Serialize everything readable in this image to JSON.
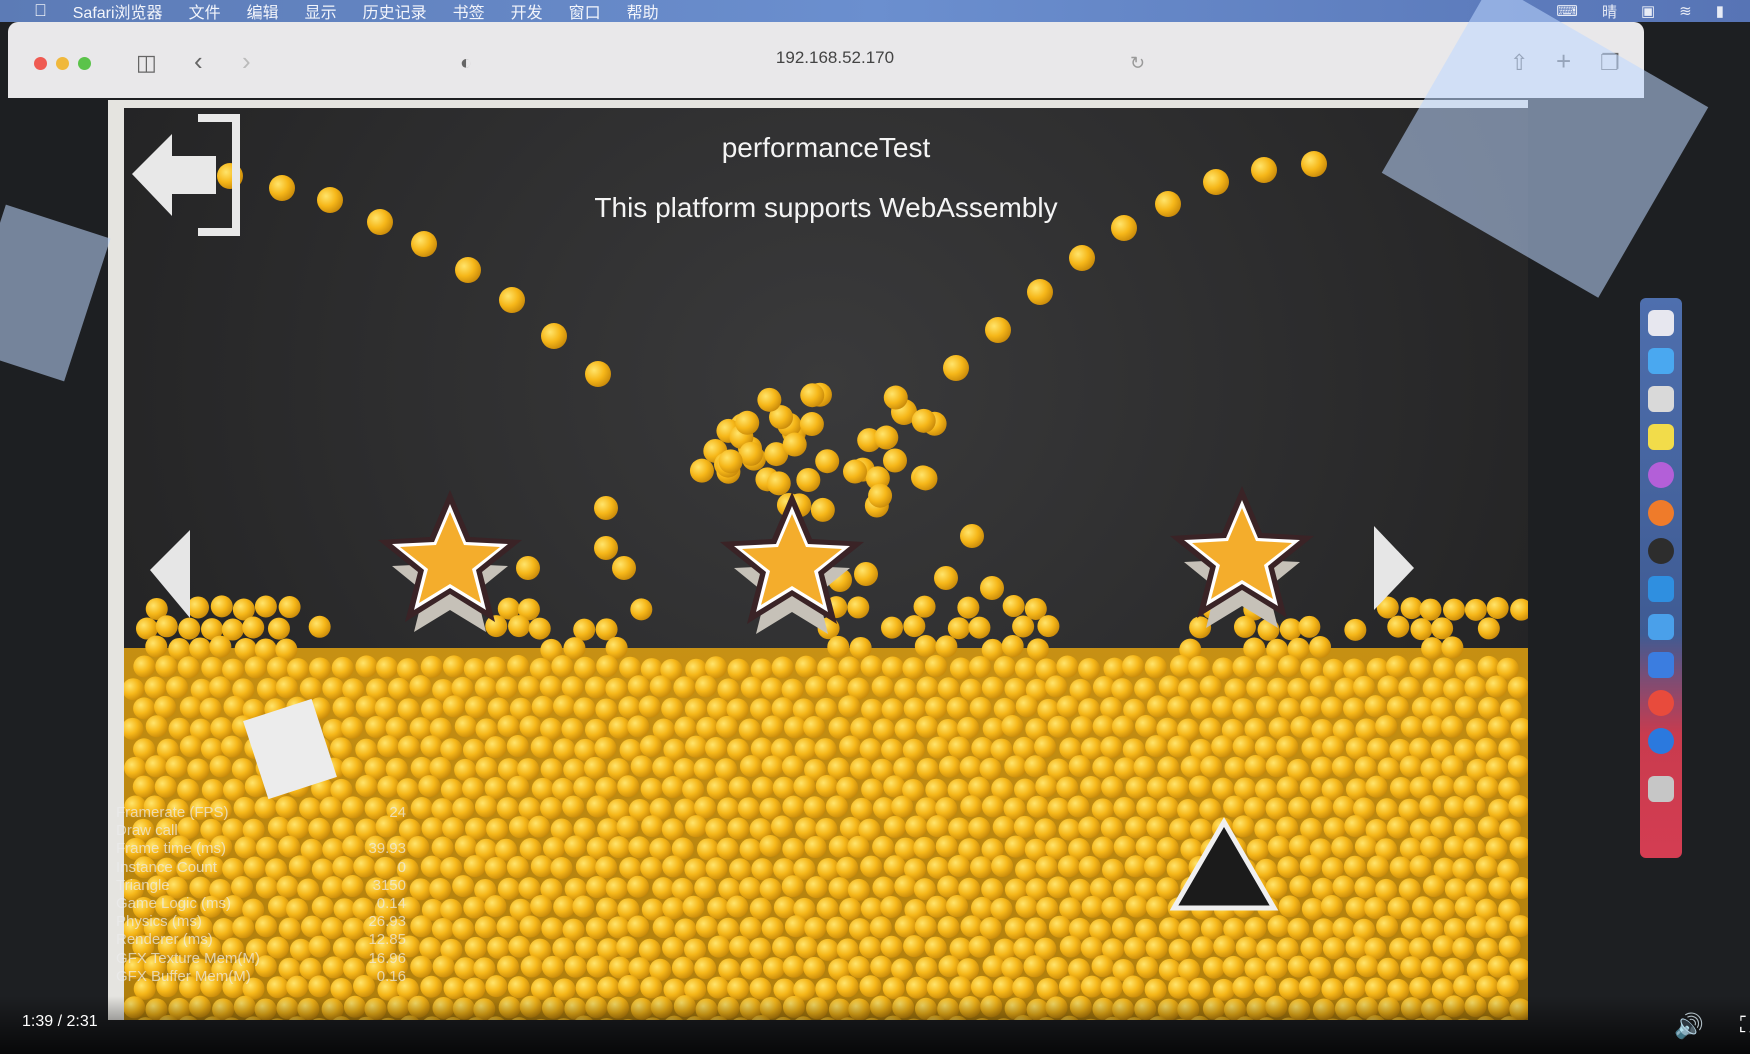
{
  "menubar": {
    "apple_icon": "apple-icon",
    "items": [
      "Safari浏览器",
      "文件",
      "编辑",
      "显示",
      "历史记录",
      "书签",
      "开发",
      "窗口",
      "帮助"
    ],
    "right_items": [
      "晴"
    ]
  },
  "browser": {
    "url": "192.168.52.170",
    "icons": [
      "sidebar-icon",
      "back-icon",
      "forward-icon",
      "shield-icon",
      "reload-icon",
      "share-icon",
      "new-tab-icon",
      "tabs-overview-icon"
    ]
  },
  "game": {
    "title": "performanceTest",
    "subtitle": "This platform supports WebAssembly",
    "icons": [
      "exit-icon",
      "prev-arrow-icon",
      "next-arrow-icon",
      "star-icon",
      "triangle-icon"
    ],
    "colors": {
      "ball": "#f2b61a",
      "star": "#f4ad2c",
      "background": "#2d2d2e"
    }
  },
  "stats": {
    "rows": [
      {
        "label": "Framerate (FPS)",
        "value": "24"
      },
      {
        "label": "Draw call",
        "value": ""
      },
      {
        "label": "Frame time (ms)",
        "value": "39.93"
      },
      {
        "label": "Instance Count",
        "value": "0"
      },
      {
        "label": "Triangle",
        "value": "3150"
      },
      {
        "label": "Game Logic (ms)",
        "value": "0.14"
      },
      {
        "label": "Physics (ms)",
        "value": "26.93"
      },
      {
        "label": "Renderer (ms)",
        "value": "12.85"
      },
      {
        "label": "GFX Texture Mem(M)",
        "value": "16.96"
      },
      {
        "label": "GFX Buffer Mem(M)",
        "value": "0.16"
      }
    ]
  },
  "video": {
    "time": "1:39 / 2:31"
  }
}
